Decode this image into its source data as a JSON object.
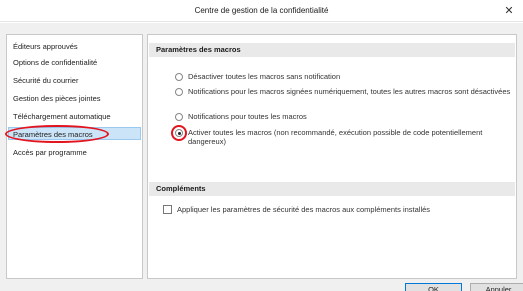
{
  "window": {
    "title": "Centre de gestion de la confidentialité",
    "close_glyph": "✕"
  },
  "sidebar": {
    "items": [
      {
        "label": "Éditeurs approuvés"
      },
      {
        "label": "Options de confidentialité"
      },
      {
        "label": "Sécurité du courrier"
      },
      {
        "label": "Gestion des pièces jointes"
      },
      {
        "label": "Téléchargement automatique"
      },
      {
        "label": "Paramètres des macros",
        "selected": true
      },
      {
        "label": "Accès par programme"
      }
    ]
  },
  "macros_section": {
    "title": "Paramètres des macros",
    "options": [
      {
        "label": "Désactiver toutes les macros sans notification",
        "checked": false
      },
      {
        "label": "Notifications pour les macros signées numériquement, toutes les autres macros sont désactivées",
        "checked": false
      },
      {
        "label": "Notifications pour toutes les macros",
        "checked": false
      },
      {
        "label": "Activer toutes les macros (non recommandé, exécution possible de code potentiellement dangereux)",
        "checked": true
      }
    ]
  },
  "addins_section": {
    "title": "Compléments",
    "checkbox_label": "Appliquer les paramètres de sécurité des macros aux compléments installés",
    "checked": false
  },
  "buttons": {
    "ok": "OK",
    "cancel": "Annuler"
  },
  "colors": {
    "highlight": "#e2141f",
    "selection": "#cce4f7"
  }
}
